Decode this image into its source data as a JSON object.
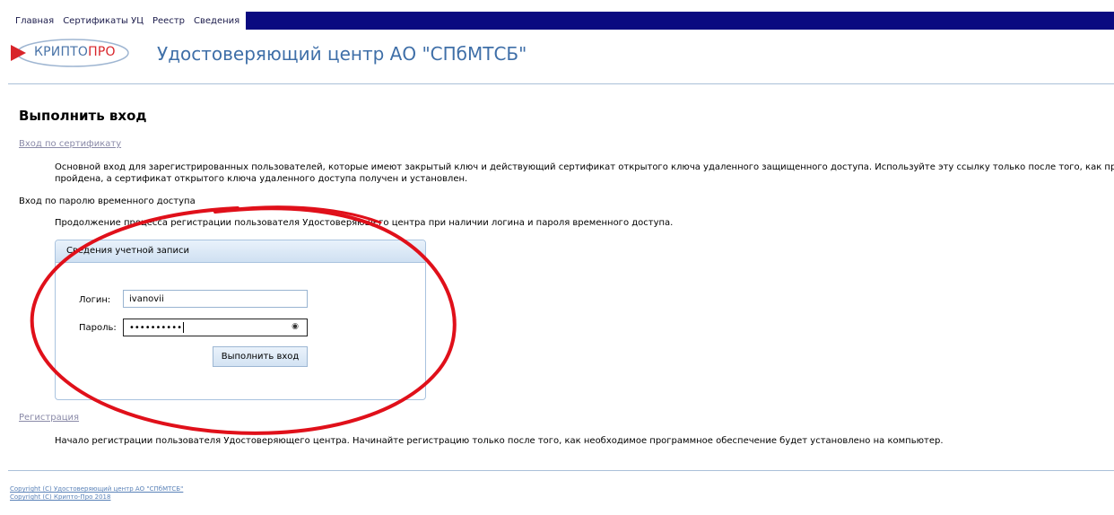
{
  "nav": {
    "items": [
      {
        "label": "Главная"
      },
      {
        "label": "Сертификаты УЦ"
      },
      {
        "label": "Реестр"
      },
      {
        "label": "Сведения"
      }
    ]
  },
  "header": {
    "logo": {
      "part1": "КРИПТО",
      "part2": "ПРО"
    },
    "title": "Удостоверяющий центр АО \"СПбМТСБ\""
  },
  "main": {
    "heading": "Выполнить вход",
    "cert_login": {
      "link": "Вход по сертификату",
      "desc_line1": "Основной вход для зарегистрированных пользователей, которые имеют закрытый ключ и действующий сертификат открытого ключа удаленного защищенного доступа. Используйте эту ссылку только после того, как процедура",
      "desc_line2": "пройдена, а сертификат открытого ключа удаленного доступа получен и установлен."
    },
    "temp_login": {
      "title": "Вход по паролю временного доступа",
      "desc": "Продолжение процесса регистрации пользователя Удостоверяющего центра при наличии логина и пароля временного доступа."
    },
    "account_panel": {
      "title": "Сведения учетной записи",
      "login_label": "Логин:",
      "login_value": "ivanovii",
      "password_label": "Пароль:",
      "password_value": "••••••••••",
      "submit": "Выполнить вход"
    },
    "registration": {
      "link": "Регистрация",
      "desc": "Начало регистрации пользователя Удостоверяющего центра. Начинайте регистрацию только после того, как необходимое программное обеспечение будет установлено на компьютер."
    }
  },
  "footer": {
    "line1": "Copyright (C) Удостоверяющий центр АО \"СПбМТСБ\"",
    "line2": "Copyright (C) Крипто-Про 2018"
  },
  "colors": {
    "nav_bar": "#0a0a80",
    "title_blue": "#3f6fa8",
    "logo_red": "#d8242a",
    "annotation_red": "#e0101a"
  }
}
